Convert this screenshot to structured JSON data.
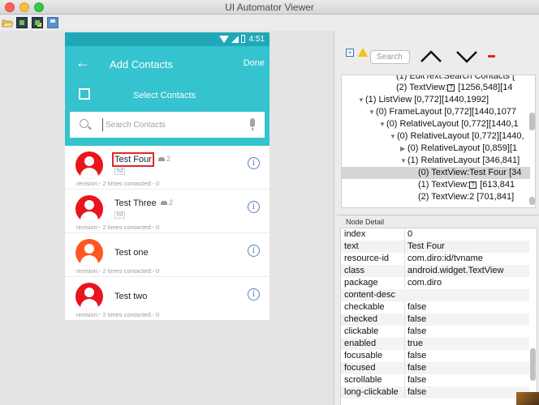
{
  "window": {
    "title": "UI Automator Viewer"
  },
  "toolbar": {
    "icons": [
      "open-folder-icon",
      "device-screenshot-icon",
      "device-screenshot-compressed-icon",
      "save-icon"
    ]
  },
  "device": {
    "status": {
      "time": "4:51"
    },
    "appbar": {
      "title": "Add Contacts",
      "done": "Done"
    },
    "select_label": "Select Contacts",
    "search_placeholder": "Search Contacts",
    "contacts": [
      {
        "name": "Test Four",
        "members": "2",
        "tag": "fsf",
        "meta": "revision:- 2   times contacted:- 0",
        "avatar_color": "#e8151c"
      },
      {
        "name": "Test Three",
        "members": "2",
        "tag": "fsf",
        "meta": "revision:- 2   times contacted:- 0",
        "avatar_color": "#e8151c"
      },
      {
        "name": "Test one",
        "members": "",
        "tag": "",
        "meta": "revision:- 2   times contacted:- 0",
        "avatar_color": "#ff5722"
      },
      {
        "name": "Test two",
        "members": "",
        "tag": "",
        "meta": "revision:- 2   times contacted:- 0",
        "avatar_color": "#e8151c"
      }
    ],
    "accent_color": "#34c3cf"
  },
  "hierarchy": {
    "search_placeholder": "Search",
    "rows": [
      {
        "arrow": "",
        "text": "(1) EditText:Search Contacts [",
        "q": false,
        "selected": false
      },
      {
        "arrow": "",
        "text": "(2) TextView:",
        "q": true,
        "after": " [1256,548][14",
        "selected": false
      },
      {
        "arrow": "▼",
        "text": "(1) ListView [0,772][1440,1992]",
        "q": false,
        "selected": false
      },
      {
        "arrow": "▼",
        "text": "(0) FrameLayout [0,772][1440,1077",
        "q": false,
        "selected": false
      },
      {
        "arrow": "▼",
        "text": "(0) RelativeLayout [0,772][1440,1",
        "q": false,
        "selected": false
      },
      {
        "arrow": "▼",
        "text": "(0) RelativeLayout [0,772][1440,",
        "q": false,
        "selected": false
      },
      {
        "arrow": "▶",
        "text": "(0) RelativeLayout [0,859][1",
        "q": false,
        "selected": false
      },
      {
        "arrow": "▼",
        "text": "(1) RelativeLayout [346,841]",
        "q": false,
        "selected": false
      },
      {
        "arrow": "",
        "text": "(0) TextView:Test Four [34",
        "q": false,
        "selected": true
      },
      {
        "arrow": "",
        "text": "(1) TextView:",
        "q": true,
        "after": " [613,841",
        "selected": false
      },
      {
        "arrow": "",
        "text": "(2) TextView:2 [701,841]",
        "q": false,
        "selected": false
      }
    ]
  },
  "node_detail": {
    "title": "Node Detail",
    "rows": [
      {
        "key": "index",
        "value": "0"
      },
      {
        "key": "text",
        "value": "Test Four"
      },
      {
        "key": "resource-id",
        "value": "com.diro:id/tvname"
      },
      {
        "key": "class",
        "value": "android.widget.TextView"
      },
      {
        "key": "package",
        "value": "com.diro"
      },
      {
        "key": "content-desc",
        "value": ""
      },
      {
        "key": "checkable",
        "value": "false"
      },
      {
        "key": "checked",
        "value": "false"
      },
      {
        "key": "clickable",
        "value": "false"
      },
      {
        "key": "enabled",
        "value": "true"
      },
      {
        "key": "focusable",
        "value": "false"
      },
      {
        "key": "focused",
        "value": "false"
      },
      {
        "key": "scrollable",
        "value": "false"
      },
      {
        "key": "long-clickable",
        "value": "false"
      }
    ]
  }
}
